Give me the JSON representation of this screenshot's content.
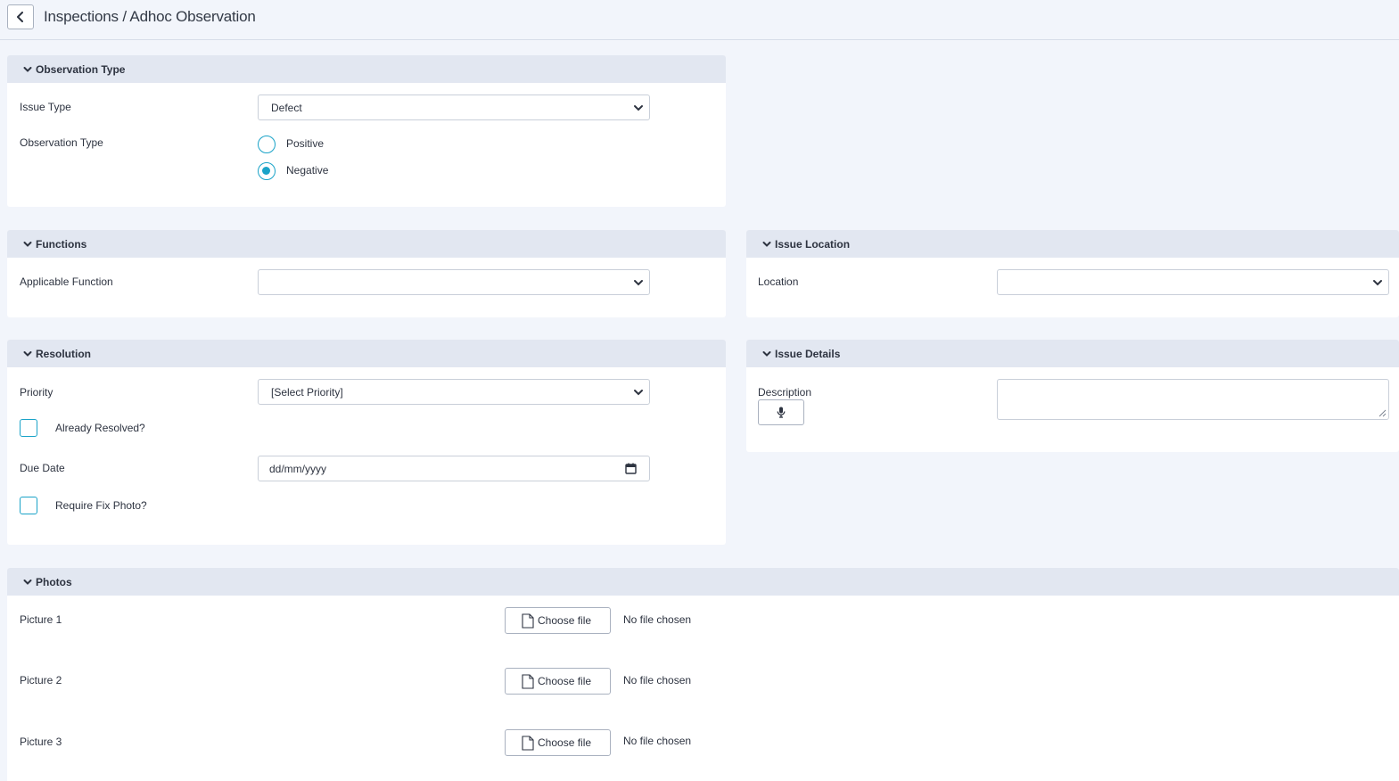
{
  "header": {
    "title": "Inspections / Adhoc Observation"
  },
  "observation_panel": {
    "title": "Observation Type",
    "issue_type_label": "Issue Type",
    "issue_type_value": "Defect",
    "observation_type_label": "Observation Type",
    "options": [
      "Positive",
      "Negative"
    ],
    "selected": "Negative"
  },
  "functions_panel": {
    "title": "Functions",
    "applicable_function_label": "Applicable Function",
    "applicable_function_value": ""
  },
  "location_panel": {
    "title": "Issue Location",
    "location_label": "Location",
    "location_value": ""
  },
  "resolution_panel": {
    "title": "Resolution",
    "priority_label": "Priority",
    "priority_value": "[Select Priority]",
    "already_resolved_label": "Already Resolved?",
    "due_date_label": "Due Date",
    "due_date_placeholder": "dd/mm/yyyy",
    "require_fix_photo_label": "Require Fix Photo?"
  },
  "details_panel": {
    "title": "Issue Details",
    "description_label": "Description",
    "description_value": ""
  },
  "photos_panel": {
    "title": "Photos",
    "choose_file_label": "Choose file",
    "pictures": [
      {
        "label": "Picture 1",
        "status": "No file chosen"
      },
      {
        "label": "Picture 2",
        "status": "No file chosen"
      },
      {
        "label": "Picture 3",
        "status": "No file chosen"
      }
    ]
  },
  "colors": {
    "accent": "#1aa3c8",
    "panel_header": "#e2e7f1",
    "background": "#f2f5fb"
  }
}
